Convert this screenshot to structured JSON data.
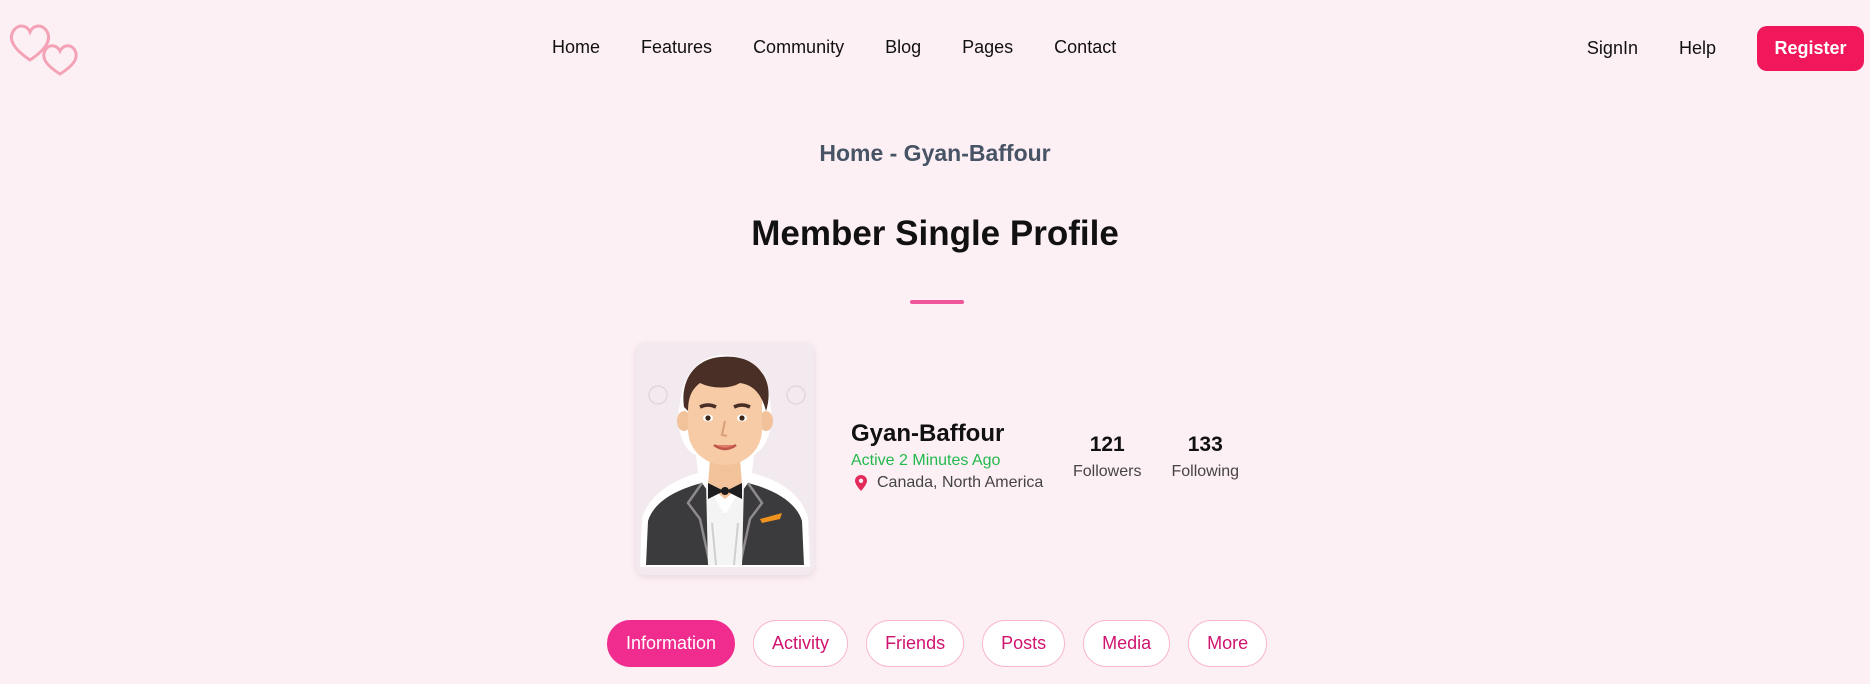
{
  "nav": {
    "items": [
      "Home",
      "Features",
      "Community",
      "Blog",
      "Pages",
      "Contact"
    ],
    "signin": "SignIn",
    "help": "Help",
    "register": "Register"
  },
  "breadcrumb": "Home - Gyan-Baffour",
  "page_title": "Member Single Profile",
  "profile": {
    "name": "Gyan-Baffour",
    "status": "Active 2 Minutes Ago",
    "location": "Canada, North America",
    "followers_count": "121",
    "followers_label": "Followers",
    "following_count": "133",
    "following_label": "Following"
  },
  "tabs": [
    "Information",
    "Activity",
    "Friends",
    "Posts",
    "Media",
    "More"
  ],
  "colors": {
    "background": "#fdf0f5",
    "accent": "#f0185a",
    "tab_active": "#f02d8e",
    "status_green": "#22b84c"
  }
}
